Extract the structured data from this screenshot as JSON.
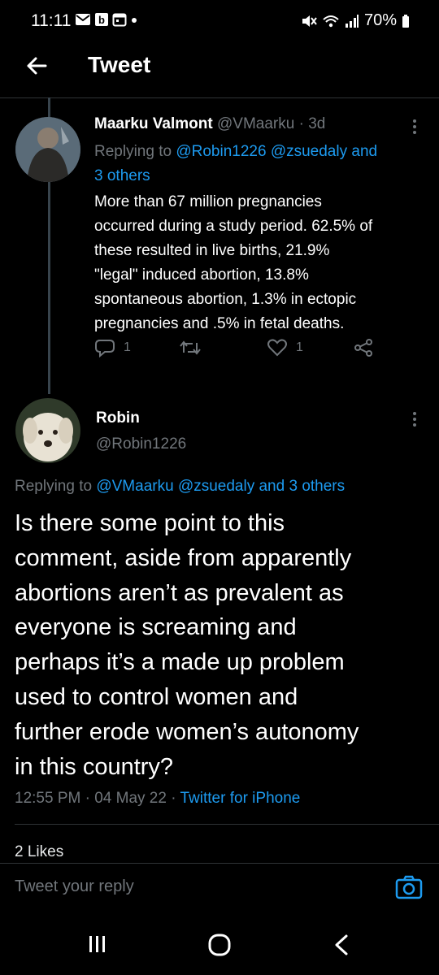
{
  "status_bar": {
    "time": "11:11",
    "battery": "70%"
  },
  "header": {
    "title": "Tweet"
  },
  "parent_tweet": {
    "author_name": "Maarku Valmont",
    "handle": "@VMaarku",
    "separator": "·",
    "age": "3d",
    "replying_prefix": "Replying to",
    "replying_mentions_line1": "@Robin1226 @zsuedaly and",
    "replying_mentions_line2": "3 others",
    "text_lines": [
      "More than 67 million pregnancies",
      "occurred during a study period. 62.5% of",
      "these resulted in live births, 21.9%",
      "\"legal\" induced abortion, 13.8%",
      "spontaneous abortion, 1.3% in ectopic",
      "pregnancies and .5% in fetal deaths."
    ],
    "reply_count": "1",
    "like_count": "1"
  },
  "main_tweet": {
    "author_name": "Robin",
    "handle": "@Robin1226",
    "replying_prefix": "Replying to",
    "replying_mentions": "@VMaarku @zsuedaly and 3 others",
    "text_lines": [
      "Is there some point to this",
      "comment, aside from apparently",
      "abortions aren’t as prevalent as",
      "everyone is screaming and",
      "perhaps it’s a made up problem",
      "used to control women and",
      "further erode women’s autonomy",
      "in this country?"
    ],
    "time": "12:55 PM",
    "separator": "·",
    "date": "04 May 22",
    "separator2": "·",
    "source": "Twitter for iPhone",
    "likes_partial": "2 Likes"
  },
  "reply_bar": {
    "placeholder": "Tweet your reply"
  },
  "colors": {
    "background": "#000000",
    "accent": "#1d9bf0",
    "muted": "#71767b",
    "divider": "#2f3336"
  }
}
